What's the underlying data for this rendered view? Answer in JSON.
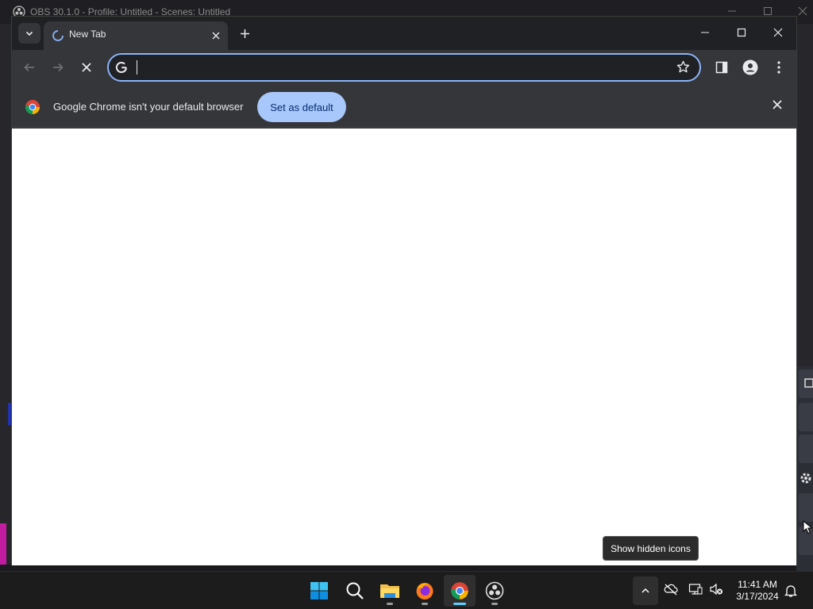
{
  "obs": {
    "title": "OBS 30.1.0 - Profile: Untitled - Scenes: Untitled"
  },
  "chrome": {
    "tab": {
      "title": "New Tab",
      "favicon": "loading-spinner-icon"
    },
    "omnibox": {
      "value": "",
      "placeholder": ""
    },
    "infobar": {
      "message": "Google Chrome isn't your default browser",
      "button": "Set as default"
    },
    "colors": {
      "accent": "#8ab4f8",
      "button_bg": "#a8c7fa",
      "frame": "#202124",
      "toolbar": "#35363a"
    }
  },
  "tooltip": {
    "text": "Show hidden icons"
  },
  "taskbar": {
    "apps": [
      {
        "name": "start-icon",
        "active": false
      },
      {
        "name": "search-icon",
        "active": false
      },
      {
        "name": "file-explorer-icon",
        "active": false,
        "running": true
      },
      {
        "name": "firefox-icon",
        "active": false,
        "running": true
      },
      {
        "name": "chrome-icon",
        "active": true,
        "running": true
      },
      {
        "name": "obs-icon",
        "active": false,
        "running": true
      }
    ],
    "tray": [
      "chevron-up-icon",
      "onedrive-offline-icon",
      "network-icon",
      "volume-muted-icon"
    ],
    "clock": {
      "time": "11:41 AM",
      "date": "3/17/2024"
    }
  }
}
